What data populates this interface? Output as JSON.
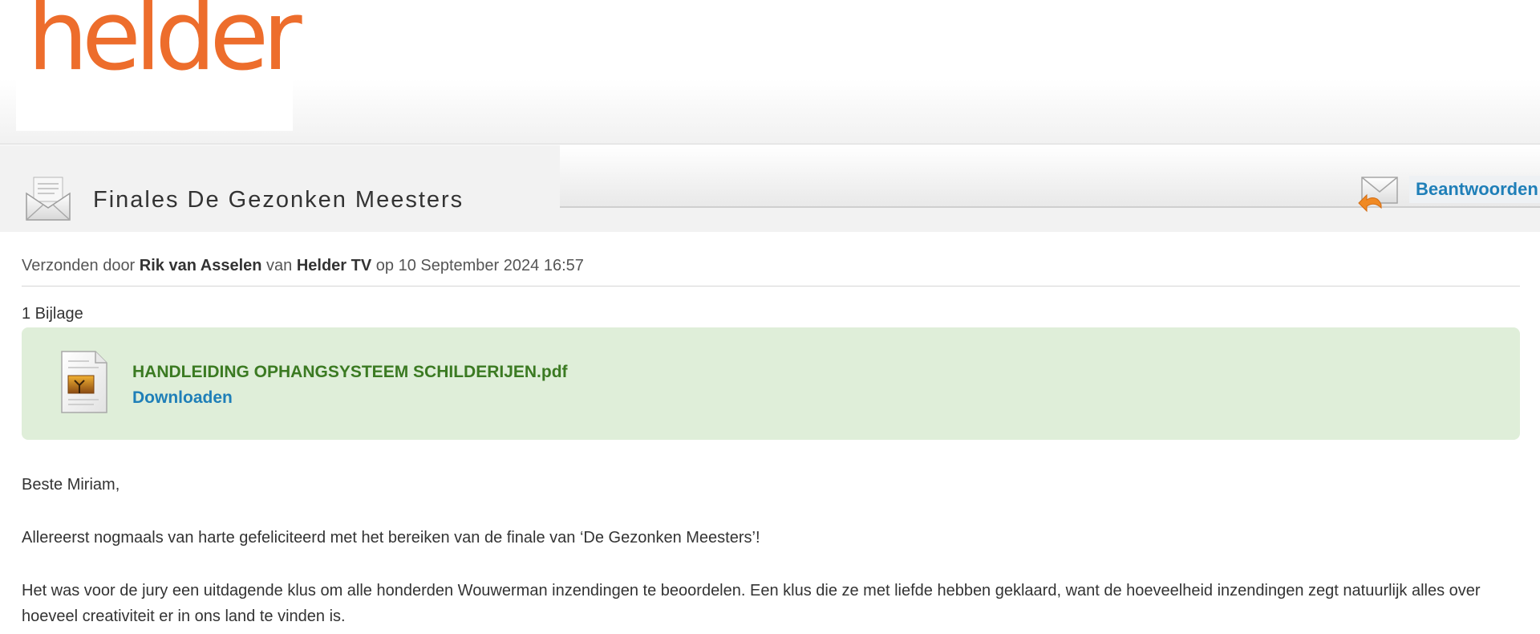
{
  "logo": {
    "text": "helder",
    "color": "#ed6d2c"
  },
  "message": {
    "subject": "Finales De Gezonken Meesters",
    "reply_label": "Beantwoorden",
    "meta": {
      "prefix": "Verzonden door",
      "sender": "Rik van Asselen",
      "from_word": "van",
      "organization": "Helder TV",
      "on_word": "op",
      "date": "10 September 2024 16:57"
    },
    "attachments": {
      "count_label": "1 Bijlage",
      "items": [
        {
          "filename": "HANDLEIDING OPHANGSYSTEEM SCHILDERIJEN.pdf",
          "download_label": "Downloaden"
        }
      ]
    },
    "body": [
      "Beste Miriam,",
      "Allereerst nogmaals van harte gefeliciteerd met het bereiken van de finale van ‘De Gezonken Meesters’!",
      "Het was voor de jury een uitdagende klus om alle honderden Wouwerman inzendingen te beoordelen. Een klus die ze met liefde hebben geklaard, want de hoeveelheid inzendingen zegt natuurlijk alles over hoeveel creativiteit er in ons land te vinden is."
    ]
  },
  "colors": {
    "accent_orange": "#ed6d2c",
    "link_blue": "#1f7fb8",
    "attachment_bg": "#dfeed9",
    "filename_green": "#3b7a22"
  },
  "icons": [
    "envelope-open-icon",
    "reply-envelope-icon",
    "pdf-file-icon"
  ]
}
